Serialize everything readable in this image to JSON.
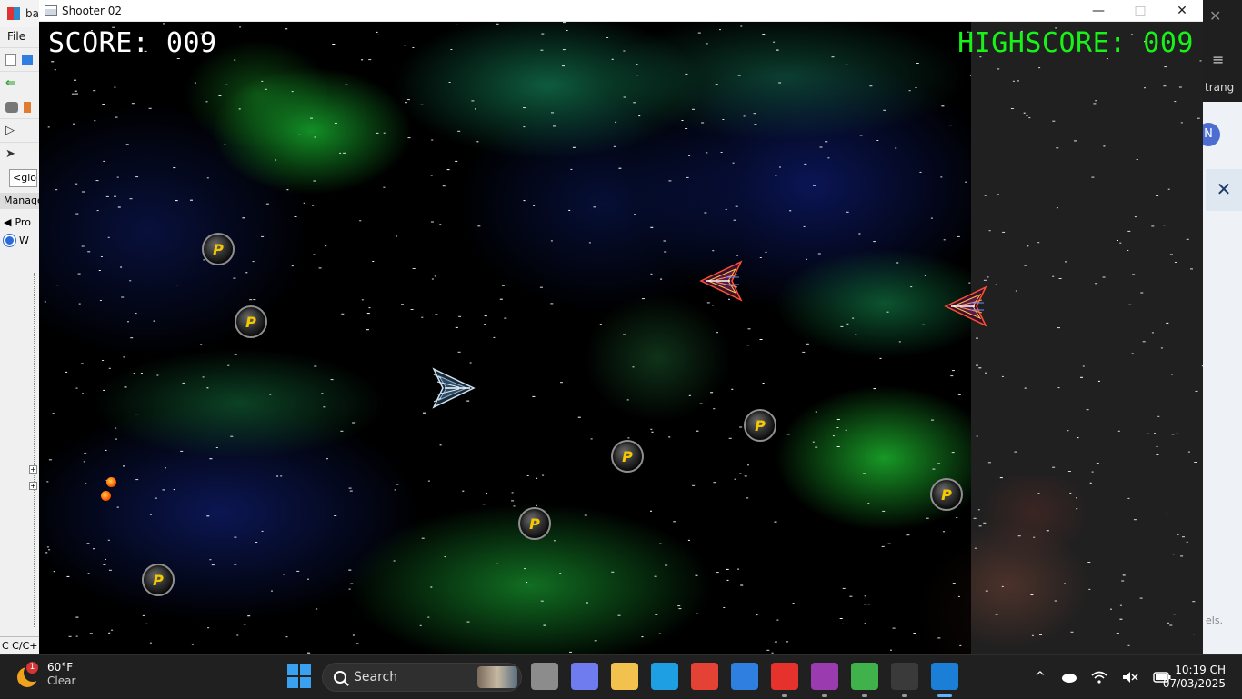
{
  "game_window": {
    "title": "Shooter 02",
    "minimize": "—",
    "maximize": "□",
    "close": "✕",
    "hud": {
      "score_label": "SCORE: 009",
      "highscore_label": "HIGHSCORE: 009"
    },
    "powerup_letter": "P"
  },
  "ide_window": {
    "title": "ba",
    "menu_file": "File",
    "combo_text": "<glol",
    "panel_title": "Manage",
    "tree_tab": "Pro",
    "tree_root": "W",
    "status_text": "C C/C+"
  },
  "browser_window": {
    "close_glyph": "✕",
    "menu_glyph": "≡",
    "label": "trang",
    "avatar_letter": "N",
    "dialog_close": "✕",
    "footer": "els."
  },
  "taskbar": {
    "weather": {
      "temp": "60°F",
      "condition": "Clear",
      "badge": "1",
      "icon": "moon-icon"
    },
    "search_label": "Search",
    "apps": [
      {
        "name": "task-view",
        "color": "#8c8c8c"
      },
      {
        "name": "copilot",
        "color": "#6e7cf0"
      },
      {
        "name": "file-explorer",
        "color": "#f2c14e"
      },
      {
        "name": "edge",
        "color": "#1f9fe3"
      },
      {
        "name": "chrome",
        "color": "#e34234"
      },
      {
        "name": "ms-store",
        "color": "#2f7fe0"
      },
      {
        "name": "wps",
        "color": "#e5322d"
      },
      {
        "name": "winrar",
        "color": "#9b3bb0"
      },
      {
        "name": "recorder",
        "color": "#3fb24b"
      },
      {
        "name": "terminal",
        "color": "#3a3a3a"
      },
      {
        "name": "shooter-game",
        "color": "#1b7fd8"
      }
    ],
    "tray": {
      "chevron": "^",
      "wifi_icon": "wifi-icon",
      "volume_icon": "volume-muted-icon",
      "battery_icon": "battery-icon",
      "onedrive_icon": "cloud-icon"
    },
    "clock": {
      "time": "10:19 CH",
      "date": "07/03/2025"
    }
  }
}
